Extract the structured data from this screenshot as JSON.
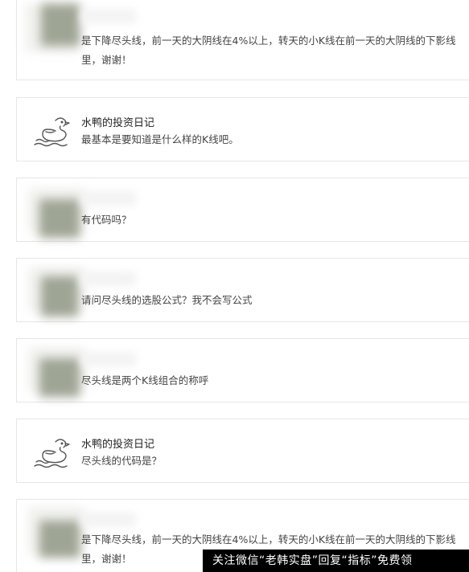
{
  "comments": [
    {
      "user": "",
      "text": "是下降尽头线，前一天的大阴线在4%以上，转天的小K线在前一天的大阴线的下影线里，谢谢！",
      "edge": "("
    },
    {
      "user": "水鸭的投资日记",
      "text": "最基本是要知道是什么样的K线吧。",
      "edge": "("
    },
    {
      "user": "",
      "text": "有代码吗？",
      "edge": "E"
    },
    {
      "user": "",
      "text": "请问尽头线的选股公式？我不会写公式",
      "edge": "E"
    },
    {
      "user": "",
      "text": "尽头线是两个K线组合的称呼",
      "edge": "E"
    },
    {
      "user": "水鸭的投资日记",
      "text": "尽头线的代码是？",
      "edge": "E"
    },
    {
      "user": "",
      "text": "是下降尽头线，前一天的大阴线在4%以上，转天的小K线在前一天的大阴线的下影线里，谢谢！",
      "edge": "夏"
    }
  ],
  "watermark": "关注微信“老韩实盘”回复“指标”免费领"
}
